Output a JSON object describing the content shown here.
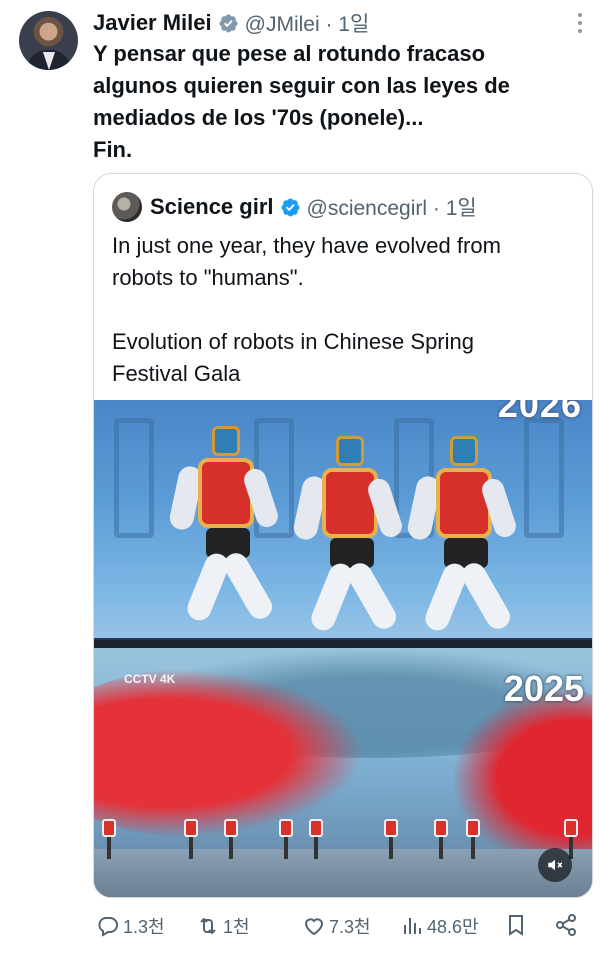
{
  "post": {
    "author_name": "Javier Milei",
    "author_handle": "@JMilei · 1일",
    "text": "Y pensar que pese al rotundo fracaso\nalgunos quieren seguir con las leyes de\nmediados de los '70s (ponele)...\nFin."
  },
  "quoted": {
    "author_name": "Science girl",
    "author_handle": "@sciencegirl · 1일",
    "text": "In just one year, they have evolved from\nrobots to \"humans\".\n\nEvolution of robots in Chinese Spring\nFestival Gala",
    "media": {
      "top_year": "2026",
      "bottom_year": "2025",
      "bottom_logo": "CCTV 4K"
    }
  },
  "actions": {
    "replies": "1.3천",
    "reposts": "1천",
    "likes": "7.3천",
    "views": "48.6만"
  },
  "colors": {
    "verified_blue": "#1d9bf0",
    "verified_gray": "#829aab",
    "muted_text": "#536471"
  },
  "icons": [
    "more-icon",
    "verified-gray-icon",
    "verified-blue-icon",
    "mute-icon",
    "reply-icon",
    "repost-icon",
    "like-icon",
    "views-icon",
    "bookmark-icon",
    "share-icon"
  ]
}
